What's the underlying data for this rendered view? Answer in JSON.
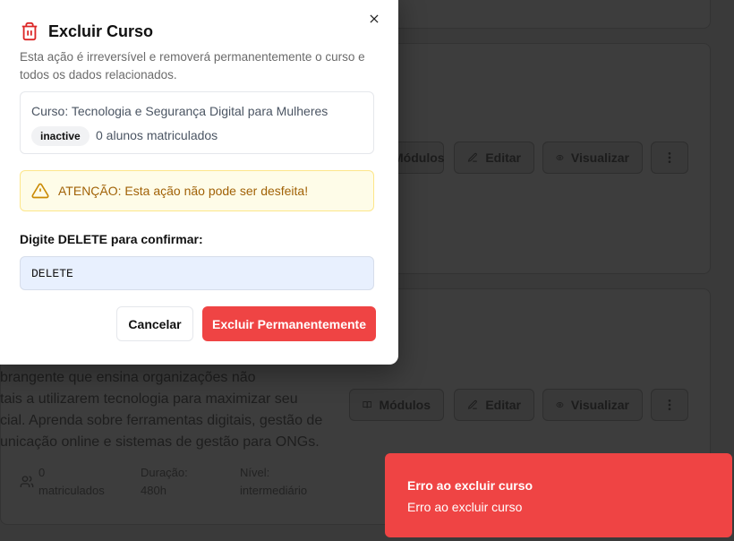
{
  "background": {
    "card1": {
      "buttons": {
        "modules": "Módulos",
        "edit": "Editar",
        "view": "Visualizar"
      }
    },
    "card2": {
      "description_lines": [
        "brangente que ensina organizações não",
        "tais a utilizarem tecnologia para maximizar seu",
        "cial. Aprenda sobre ferramentas digitais, gestão de",
        "unicação online e sistemas de gestão para ONGs."
      ],
      "buttons": {
        "modules": "Módulos",
        "edit": "Editar",
        "view": "Visualizar"
      },
      "meta": {
        "enrolled_count": "0",
        "enrolled_label": "matriculados",
        "duration_label": "Duração:",
        "duration_value": "480h",
        "level_label": "Nível:",
        "level_value": "intermediário"
      }
    }
  },
  "modal": {
    "title": "Excluir Curso",
    "description": "Esta ação é irreversível e removerá permanentemente o curso e todos os dados relacionados.",
    "course": {
      "name": "Curso: Tecnologia e Segurança Digital para Mulheres",
      "status": "inactive",
      "enrolled": "0 alunos matriculados"
    },
    "warning": "ATENÇÃO: Esta ação não pode ser desfeita!",
    "confirm_prefix": "Digite ",
    "confirm_keyword": "DELETE",
    "confirm_suffix": " para confirmar:",
    "input_value": "DELETE",
    "cancel_label": "Cancelar",
    "delete_label": "Excluir Permanentemente"
  },
  "toast": {
    "title": "Erro ao excluir curso",
    "description": "Erro ao excluir curso"
  },
  "colors": {
    "danger": "#ef4444",
    "warning_bg": "#fefce8",
    "warning_text": "#a16207",
    "overlay": "#3a3a3a"
  },
  "icons": {
    "title": "trash-icon",
    "close": "close-icon",
    "warning": "warning-triangle-icon",
    "modules": "book-open-icon",
    "edit": "edit-icon",
    "view": "eye-icon",
    "more": "more-vertical-icon",
    "users": "users-icon"
  }
}
